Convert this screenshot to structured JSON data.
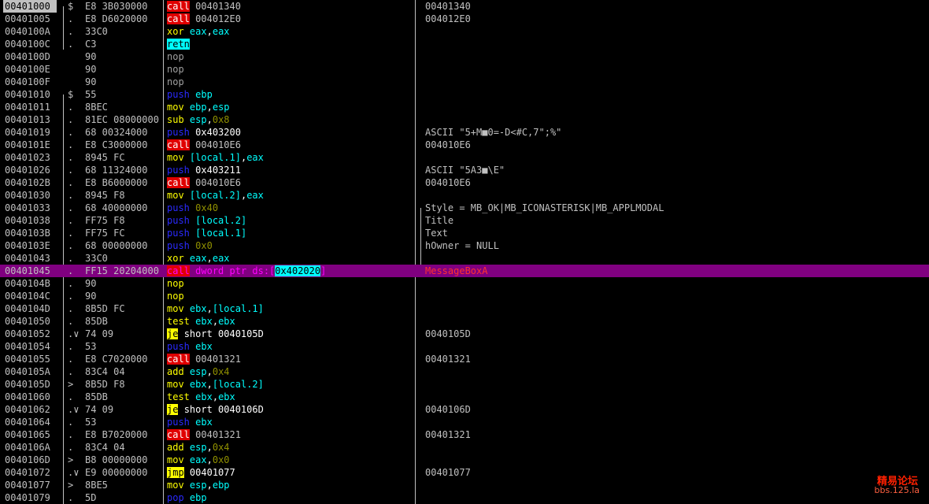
{
  "rows": [
    {
      "addr": "00401000",
      "mark": "$",
      "hex": "E8 3B030000",
      "mnem": "call",
      "mclass": "call",
      "ops": [
        [
          "00401340",
          "imm"
        ]
      ],
      "cmt": "00401340",
      "sel": true
    },
    {
      "addr": "00401005",
      "mark": ".",
      "hex": "E8 D6020000",
      "mnem": "call",
      "mclass": "call",
      "ops": [
        [
          "004012E0",
          "imm"
        ]
      ],
      "cmt": "004012E0"
    },
    {
      "addr": "0040100A",
      "mark": ".",
      "hex": "33C0",
      "mnem": "xor",
      "mclass": "norm",
      "ops": [
        [
          "eax",
          "reg"
        ],
        [
          ",",
          "plain"
        ],
        [
          "eax",
          "reg"
        ]
      ],
      "cmt": ""
    },
    {
      "addr": "0040100C",
      "mark": ".",
      "hex": "C3",
      "mnem": "retn",
      "mclass": "retn",
      "ops": [],
      "cmt": ""
    },
    {
      "addr": "0040100D",
      "mark": "",
      "hex": "90",
      "mnem": "nop",
      "mclass": "nop",
      "ops": [],
      "cmt": ""
    },
    {
      "addr": "0040100E",
      "mark": "",
      "hex": "90",
      "mnem": "nop",
      "mclass": "nop",
      "ops": [],
      "cmt": ""
    },
    {
      "addr": "0040100F",
      "mark": "",
      "hex": "90",
      "mnem": "nop",
      "mclass": "nop",
      "ops": [],
      "cmt": ""
    },
    {
      "addr": "00401010",
      "mark": "$",
      "hex": "55",
      "mnem": "push",
      "mclass": "push",
      "ops": [
        [
          "ebp",
          "reg"
        ]
      ],
      "cmt": ""
    },
    {
      "addr": "00401011",
      "mark": ".",
      "hex": "8BEC",
      "mnem": "mov",
      "mclass": "norm",
      "ops": [
        [
          "ebp",
          "reg"
        ],
        [
          ",",
          "plain"
        ],
        [
          "esp",
          "reg"
        ]
      ],
      "cmt": ""
    },
    {
      "addr": "00401013",
      "mark": ".",
      "hex": "81EC 08000000",
      "mnem": "sub",
      "mclass": "norm",
      "ops": [
        [
          "esp",
          "reg"
        ],
        [
          ",",
          "plain"
        ],
        [
          "0x8",
          "num"
        ]
      ],
      "cmt": ""
    },
    {
      "addr": "00401019",
      "mark": ".",
      "hex": "68 00324000",
      "mnem": "push",
      "mclass": "push",
      "ops": [
        [
          "0x403200",
          "plain"
        ]
      ],
      "cmt": "ASCII \"5+M■0=-D<#C,7\";%\""
    },
    {
      "addr": "0040101E",
      "mark": ".",
      "hex": "E8 C3000000",
      "mnem": "call",
      "mclass": "call",
      "ops": [
        [
          "004010E6",
          "imm"
        ]
      ],
      "cmt": "004010E6"
    },
    {
      "addr": "00401023",
      "mark": ".",
      "hex": "8945 FC",
      "mnem": "mov",
      "mclass": "norm",
      "ops": [
        [
          "[local.1]",
          "mem"
        ],
        [
          ",",
          "plain"
        ],
        [
          "eax",
          "reg"
        ]
      ],
      "cmt": ""
    },
    {
      "addr": "00401026",
      "mark": ".",
      "hex": "68 11324000",
      "mnem": "push",
      "mclass": "push",
      "ops": [
        [
          "0x403211",
          "plain"
        ]
      ],
      "cmt": "ASCII \"5A3■\\E\""
    },
    {
      "addr": "0040102B",
      "mark": ".",
      "hex": "E8 B6000000",
      "mnem": "call",
      "mclass": "call",
      "ops": [
        [
          "004010E6",
          "imm"
        ]
      ],
      "cmt": "004010E6"
    },
    {
      "addr": "00401030",
      "mark": ".",
      "hex": "8945 F8",
      "mnem": "mov",
      "mclass": "norm",
      "ops": [
        [
          "[local.2]",
          "mem"
        ],
        [
          ",",
          "plain"
        ],
        [
          "eax",
          "reg"
        ]
      ],
      "cmt": ""
    },
    {
      "addr": "00401033",
      "mark": ".",
      "hex": "68 40000000",
      "mnem": "push",
      "mclass": "push",
      "ops": [
        [
          "0x40",
          "num"
        ]
      ],
      "cmt": "Style = MB_OK|MB_ICONASTERISK|MB_APPLMODAL"
    },
    {
      "addr": "00401038",
      "mark": ".",
      "hex": "FF75 F8",
      "mnem": "push",
      "mclass": "push",
      "ops": [
        [
          "[local.2]",
          "mem"
        ]
      ],
      "cmt": "Title"
    },
    {
      "addr": "0040103B",
      "mark": ".",
      "hex": "FF75 FC",
      "mnem": "push",
      "mclass": "push",
      "ops": [
        [
          "[local.1]",
          "mem"
        ]
      ],
      "cmt": "Text"
    },
    {
      "addr": "0040103E",
      "mark": ".",
      "hex": "68 00000000",
      "mnem": "push",
      "mclass": "push",
      "ops": [
        [
          "0x0",
          "num"
        ]
      ],
      "cmt": "hOwner = NULL"
    },
    {
      "addr": "00401043",
      "mark": ".",
      "hex": "33C0",
      "mnem": "xor",
      "mclass": "norm",
      "ops": [
        [
          "eax",
          "reg"
        ],
        [
          ",",
          "plain"
        ],
        [
          "eax",
          "reg"
        ]
      ],
      "cmt": ""
    },
    {
      "addr": "00401045",
      "mark": ".",
      "hex": "FF15 20204000",
      "mnem": "call",
      "mclass": "call",
      "ops": [
        [
          "dword ptr ds:[",
          "plain"
        ],
        [
          "0x402020",
          "box"
        ],
        [
          "]",
          "plain"
        ]
      ],
      "cmt": "MessageBoxA",
      "hl": true
    },
    {
      "addr": "0040104B",
      "mark": ".",
      "hex": "90",
      "mnem": "nop",
      "mclass": "norm",
      "ops": [],
      "cmt": ""
    },
    {
      "addr": "0040104C",
      "mark": ".",
      "hex": "90",
      "mnem": "nop",
      "mclass": "norm",
      "ops": [],
      "cmt": ""
    },
    {
      "addr": "0040104D",
      "mark": ".",
      "hex": "8B5D FC",
      "mnem": "mov",
      "mclass": "norm",
      "ops": [
        [
          "ebx",
          "reg"
        ],
        [
          ",",
          "plain"
        ],
        [
          "[local.1]",
          "mem"
        ]
      ],
      "cmt": ""
    },
    {
      "addr": "00401050",
      "mark": ".",
      "hex": "85DB",
      "mnem": "test",
      "mclass": "norm",
      "ops": [
        [
          "ebx",
          "reg"
        ],
        [
          ",",
          "plain"
        ],
        [
          "ebx",
          "reg"
        ]
      ],
      "cmt": ""
    },
    {
      "addr": "00401052",
      "mark": ".∨",
      "hex": "74 09",
      "mnem": "je",
      "mclass": "jcc",
      "ops": [
        [
          "short 0040105D",
          "plain"
        ]
      ],
      "cmt": "0040105D"
    },
    {
      "addr": "00401054",
      "mark": ".",
      "hex": "53",
      "mnem": "push",
      "mclass": "push",
      "ops": [
        [
          "ebx",
          "reg"
        ]
      ],
      "cmt": ""
    },
    {
      "addr": "00401055",
      "mark": ".",
      "hex": "E8 C7020000",
      "mnem": "call",
      "mclass": "call",
      "ops": [
        [
          "00401321",
          "imm"
        ]
      ],
      "cmt": "00401321"
    },
    {
      "addr": "0040105A",
      "mark": ".",
      "hex": "83C4 04",
      "mnem": "add",
      "mclass": "norm",
      "ops": [
        [
          "esp",
          "reg"
        ],
        [
          ",",
          "plain"
        ],
        [
          "0x4",
          "num"
        ]
      ],
      "cmt": ""
    },
    {
      "addr": "0040105D",
      "mark": ">",
      "hex": "8B5D F8",
      "mnem": "mov",
      "mclass": "norm",
      "ops": [
        [
          "ebx",
          "reg"
        ],
        [
          ",",
          "plain"
        ],
        [
          "[local.2]",
          "mem"
        ]
      ],
      "cmt": ""
    },
    {
      "addr": "00401060",
      "mark": ".",
      "hex": "85DB",
      "mnem": "test",
      "mclass": "norm",
      "ops": [
        [
          "ebx",
          "reg"
        ],
        [
          ",",
          "plain"
        ],
        [
          "ebx",
          "reg"
        ]
      ],
      "cmt": ""
    },
    {
      "addr": "00401062",
      "mark": ".∨",
      "hex": "74 09",
      "mnem": "je",
      "mclass": "jcc",
      "ops": [
        [
          "short 0040106D",
          "plain"
        ]
      ],
      "cmt": "0040106D"
    },
    {
      "addr": "00401064",
      "mark": ".",
      "hex": "53",
      "mnem": "push",
      "mclass": "push",
      "ops": [
        [
          "ebx",
          "reg"
        ]
      ],
      "cmt": ""
    },
    {
      "addr": "00401065",
      "mark": ".",
      "hex": "E8 B7020000",
      "mnem": "call",
      "mclass": "call",
      "ops": [
        [
          "00401321",
          "imm"
        ]
      ],
      "cmt": "00401321"
    },
    {
      "addr": "0040106A",
      "mark": ".",
      "hex": "83C4 04",
      "mnem": "add",
      "mclass": "norm",
      "ops": [
        [
          "esp",
          "reg"
        ],
        [
          ",",
          "plain"
        ],
        [
          "0x4",
          "num"
        ]
      ],
      "cmt": ""
    },
    {
      "addr": "0040106D",
      "mark": ">",
      "hex": "B8 00000000",
      "mnem": "mov",
      "mclass": "norm",
      "ops": [
        [
          "eax",
          "reg"
        ],
        [
          ",",
          "plain"
        ],
        [
          "0x0",
          "num"
        ]
      ],
      "cmt": ""
    },
    {
      "addr": "00401072",
      "mark": ".∨",
      "hex": "E9 00000000",
      "mnem": "jmp",
      "mclass": "jcc",
      "ops": [
        [
          "00401077",
          "plain"
        ]
      ],
      "cmt": "00401077"
    },
    {
      "addr": "00401077",
      "mark": ">",
      "hex": "8BE5",
      "mnem": "mov",
      "mclass": "norm",
      "ops": [
        [
          "esp",
          "reg"
        ],
        [
          ",",
          "plain"
        ],
        [
          "ebp",
          "reg"
        ]
      ],
      "cmt": ""
    },
    {
      "addr": "00401079",
      "mark": ".",
      "hex": "5D",
      "mnem": "pop",
      "mclass": "push",
      "ops": [
        [
          "ebp",
          "reg"
        ]
      ],
      "cmt": ""
    }
  ],
  "watermark": {
    "line1": "精易论坛",
    "line2": "bbs.125.la"
  }
}
